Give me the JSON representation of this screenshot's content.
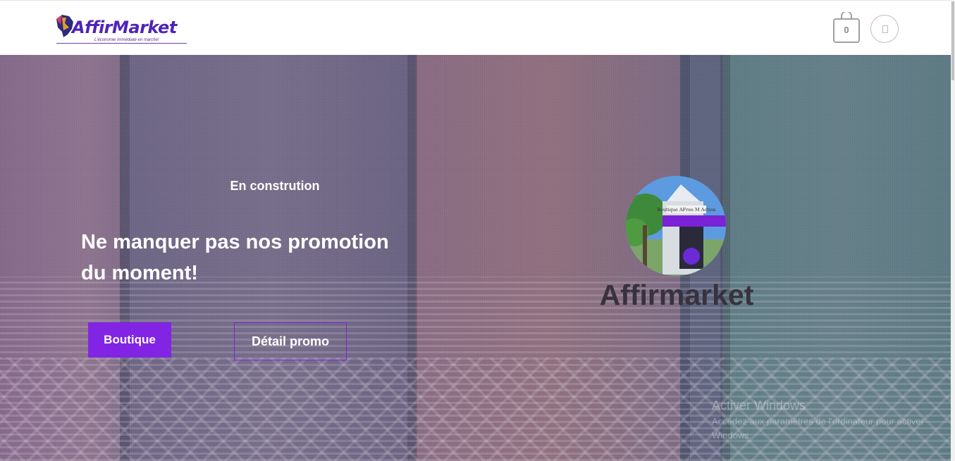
{
  "header": {
    "logo_text": "AffirMarket",
    "logo_tagline": "L'économie immédiate en marche!",
    "cart_count": "0",
    "cart_icon": "shopping-bag-icon",
    "account_icon": "user-icon"
  },
  "hero": {
    "subtitle": "En constrution",
    "title": "Ne manquer pas nos promotion du moment!",
    "primary_button": "Boutique",
    "secondary_button": "Détail promo",
    "store_name": "Affirmarket",
    "store_sign": "Boutique AFree M Action"
  },
  "watermark": {
    "title": "Activer Windows",
    "text": "Accédez aux paramètres de l'ordinateur pour activer Windows."
  },
  "colors": {
    "accent": "#8224e3",
    "logo": "#4f24b8",
    "store_name": "#38323f"
  }
}
